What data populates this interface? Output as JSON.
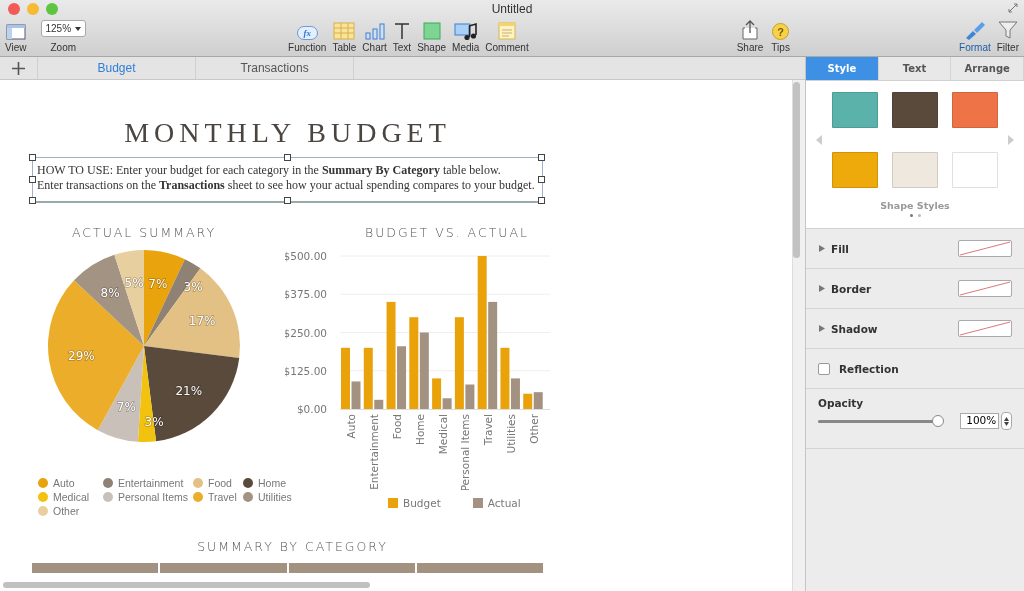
{
  "window": {
    "title": "Untitled"
  },
  "toolbar": {
    "left": [
      {
        "label": "View",
        "kind": "view"
      },
      {
        "label": "Zoom",
        "kind": "zoom",
        "value": "125%"
      }
    ],
    "insert": [
      {
        "label": "Function",
        "kind": "function",
        "icon_text": "fx"
      },
      {
        "label": "Table",
        "kind": "table"
      },
      {
        "label": "Chart",
        "kind": "chart"
      },
      {
        "label": "Text",
        "kind": "text"
      },
      {
        "label": "Shape",
        "kind": "shape"
      },
      {
        "label": "Media",
        "kind": "media"
      },
      {
        "label": "Comment",
        "kind": "comment"
      }
    ],
    "share": [
      {
        "label": "Share",
        "kind": "share"
      },
      {
        "label": "Tips",
        "kind": "tips",
        "icon_text": "?"
      }
    ],
    "panels": [
      {
        "label": "Format",
        "kind": "format",
        "selected": true
      },
      {
        "label": "Filter",
        "kind": "filter",
        "selected": false
      }
    ]
  },
  "sheet_tabs": [
    {
      "label": "Budget",
      "selected": true
    },
    {
      "label": "Transactions",
      "selected": false
    }
  ],
  "document": {
    "title": "MONTHLY BUDGET",
    "instructions": [
      "HOW TO USE: Enter your budget for each category in the **Summary By Category** table below.",
      "Enter transactions on the **Transactions** sheet to see how your actual spending compares to your budget."
    ],
    "pie": {
      "chart_data": {
        "type": "pie",
        "title": "ACTUAL SUMMARY",
        "categories": [
          "Auto",
          "Entertainment",
          "Food",
          "Home",
          "Medical",
          "Personal Items",
          "Travel",
          "Utilities",
          "Other"
        ],
        "series": [
          {
            "values": [
              7,
              3,
              17,
              21,
              3,
              7,
              29,
              8,
              5
            ]
          }
        ],
        "value_labels": [
          "7%",
          "3%",
          "17%",
          "21%",
          "3%",
          "7%",
          "29%",
          "8%",
          "5%"
        ]
      },
      "legend": [
        {
          "color": "#e9a30c"
        },
        {
          "color": "#8f8275"
        },
        {
          "color": "#e3c185"
        },
        {
          "color": "#5a4a3b"
        },
        {
          "color": "#f2c20e"
        },
        {
          "color": "#c9c1b9"
        },
        {
          "color": "#ecae2a"
        },
        {
          "color": "#a39382"
        },
        {
          "color": "#e8cf9f"
        }
      ]
    },
    "bar": {
      "chart_data": {
        "type": "bar",
        "title": "BUDGET VS. ACTUAL",
        "categories": [
          "Auto",
          "Entertainment",
          "Food",
          "Home",
          "Medical",
          "Personal Items",
          "Travel",
          "Utilities",
          "Other"
        ],
        "series": [
          {
            "name": "Budget",
            "color": "#eaa20b",
            "values": [
              200,
              200,
              350,
              300,
              100,
              300,
              500,
              200,
              50
            ]
          },
          {
            "name": "Actual",
            "color": "#a39282",
            "values": [
              90,
              30,
              205,
              250,
              35,
              80,
              350,
              100,
              55
            ]
          }
        ],
        "ylim": [
          0,
          500
        ],
        "grid": true,
        "yticks": [
          {
            "value": 0,
            "label": "$0.00"
          },
          {
            "value": 125,
            "label": "$125.00"
          },
          {
            "value": 250,
            "label": "$250.00"
          },
          {
            "value": 375,
            "label": "$375.00"
          },
          {
            "value": 500,
            "label": "$500.00"
          }
        ]
      }
    },
    "table_title": "SUMMARY BY CATEGORY"
  },
  "inspector": {
    "tabs": [
      {
        "label": "Style",
        "selected": true
      },
      {
        "label": "Text",
        "selected": false
      },
      {
        "label": "Arrange",
        "selected": false
      }
    ],
    "shape_styles": [
      {
        "color": "#5bb2aa"
      },
      {
        "color": "#5a4a3b"
      },
      {
        "color": "#ee7448"
      },
      {
        "color": "#eea90a"
      },
      {
        "color": "#efe8df"
      },
      {
        "color": "#ffffff"
      }
    ],
    "styles_label": "Shape Styles",
    "pages": [
      {
        "selected": true
      },
      {
        "selected": false
      }
    ],
    "properties": [
      {
        "kind": "disclosure",
        "label": "Fill",
        "expanded": false
      },
      {
        "kind": "disclosure",
        "label": "Border",
        "expanded": false
      },
      {
        "kind": "disclosure",
        "label": "Shadow",
        "expanded": false
      },
      {
        "kind": "checkbox",
        "label": "Reflection",
        "checked": false
      }
    ],
    "opacity": {
      "label": "Opacity",
      "level": 1,
      "value": "100%"
    }
  }
}
